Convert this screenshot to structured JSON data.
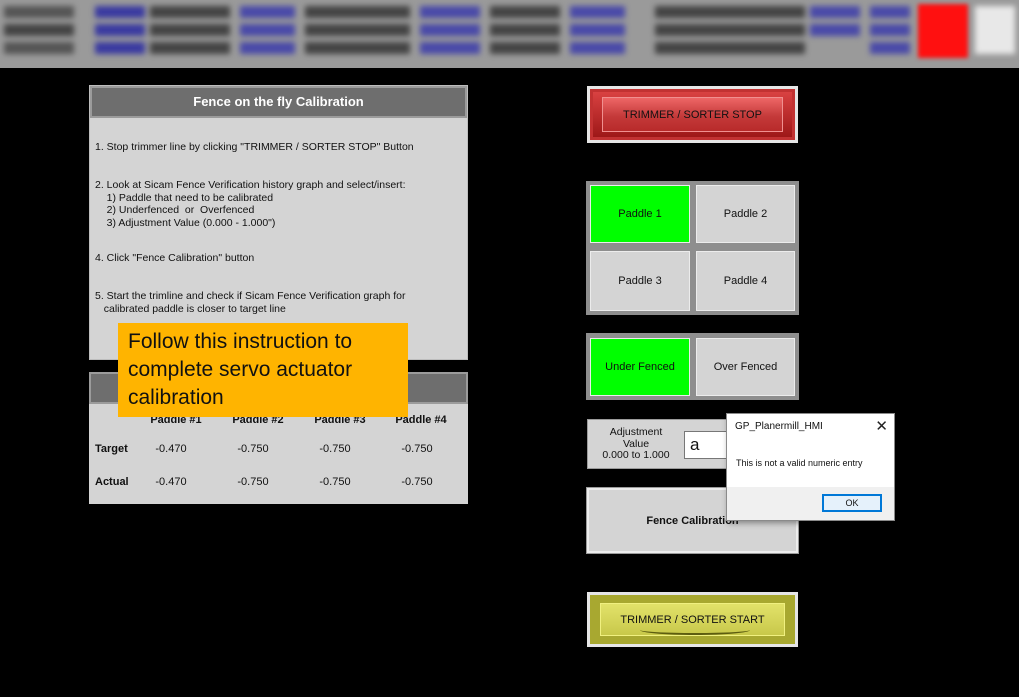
{
  "colors": {
    "background": "#000000",
    "panel": "#d4d4d4",
    "panel_header": "#6e6e6e",
    "active_toggle": "#00ff00",
    "stop_button": "#c43a3a",
    "start_button": "#c8c84a",
    "callout": "#ffb400",
    "alarm_indicator": "#ff1010"
  },
  "instructions_panel": {
    "title": "Fence on the fly Calibration",
    "steps": [
      "1. Stop trimmer line by clicking \"TRIMMER / SORTER STOP\" Button",
      "2. Look at Sicam Fence Verification history graph and select/insert:\n    1) Paddle that need to be calibrated\n    2) Underfenced  or  Overfenced\n    3) Adjustment Value (0.000 - 1.000\")",
      "4. Click \"Fence Calibration\" button",
      "5. Start the trimline and check if Sicam Fence Verification graph for\n   calibrated paddle is closer to target line"
    ]
  },
  "callout": {
    "text": "Follow this instruction to complete servo actuator calibration"
  },
  "values_table": {
    "columns": [
      "Paddle #1",
      "Paddle #2",
      "Paddle #3",
      "Paddle #4"
    ],
    "rows": [
      {
        "label": "Target",
        "values": [
          "-0.470",
          "-0.750",
          "-0.750",
          "-0.750"
        ]
      },
      {
        "label": "Actual",
        "values": [
          "-0.470",
          "-0.750",
          "-0.750",
          "-0.750"
        ]
      }
    ]
  },
  "controls": {
    "stop_label": "TRIMMER / SORTER STOP",
    "start_label": "TRIMMER / SORTER START",
    "paddles": [
      {
        "label": "Paddle 1",
        "selected": true
      },
      {
        "label": "Paddle 2",
        "selected": false
      },
      {
        "label": "Paddle 3",
        "selected": false
      },
      {
        "label": "Paddle 4",
        "selected": false
      }
    ],
    "fence_modes": [
      {
        "label": "Under Fenced",
        "selected": true
      },
      {
        "label": "Over Fenced",
        "selected": false
      }
    ],
    "adjustment": {
      "label_line1": "Adjustment",
      "label_line2": "Value",
      "label_line3": "0.000 to 1.000",
      "input_value": "a"
    },
    "calibration_label": "Fence Calibration"
  },
  "dialog": {
    "title": "GP_Planermill_HMI",
    "close_icon": "close-icon",
    "message": "This is not a valid numeric entry",
    "ok_label": "OK"
  }
}
